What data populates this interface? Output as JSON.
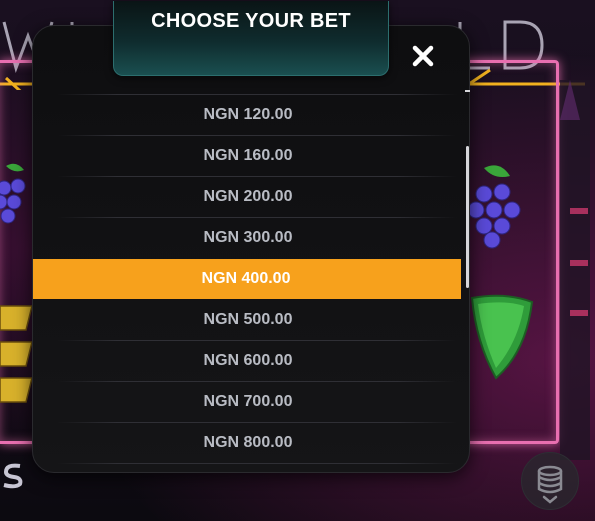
{
  "modal": {
    "title": "CHOOSE YOUR BET",
    "close_icon": "close-icon",
    "bet_options": [
      {
        "label": "NGN 120.00",
        "selected": false
      },
      {
        "label": "NGN 160.00",
        "selected": false
      },
      {
        "label": "NGN 200.00",
        "selected": false
      },
      {
        "label": "NGN 300.00",
        "selected": false
      },
      {
        "label": "NGN 400.00",
        "selected": true
      },
      {
        "label": "NGN 500.00",
        "selected": false
      },
      {
        "label": "NGN 600.00",
        "selected": false
      },
      {
        "label": "NGN 700.00",
        "selected": false
      },
      {
        "label": "NGN 800.00",
        "selected": false
      }
    ]
  },
  "background": {
    "sign_icon": "neon-wild-sign-icon",
    "symbols": [
      "grapes-icon",
      "bar-icon",
      "melon-icon"
    ]
  },
  "controls": {
    "coin_stack_icon": "coin-stack-icon"
  },
  "colors": {
    "selected_row": "#f7a11c",
    "header_teal": "#1a4f50",
    "neon_pink": "#e86fb0",
    "text_muted": "#b9bcc4"
  }
}
